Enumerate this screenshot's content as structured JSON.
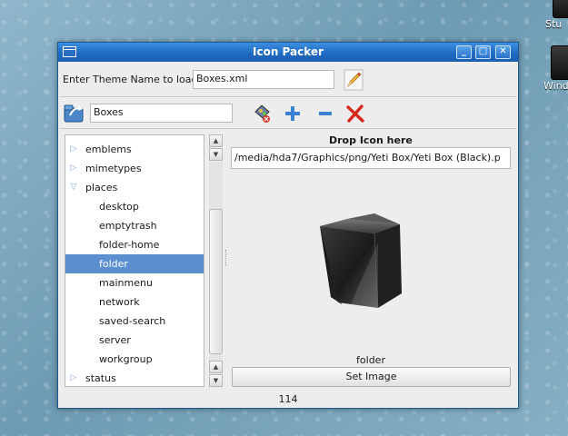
{
  "desktop": {
    "icons": [
      {
        "label": "Stu",
        "icon": "drive-icon"
      },
      {
        "label": "Wind",
        "icon": "drive-icon"
      }
    ]
  },
  "window": {
    "title": "Icon Packer",
    "controls": {
      "minimize": "_",
      "maximize": "□",
      "close": "✕"
    }
  },
  "theme_row": {
    "label": "Enter Theme Name to load",
    "value": "Boxes.xml",
    "edit_icon": "pencil-icon"
  },
  "toolbar": {
    "name_value": "Boxes",
    "icons": [
      "open-folder-icon",
      "palette-icon",
      "add-icon",
      "remove-icon",
      "delete-icon"
    ]
  },
  "tree": {
    "items": [
      {
        "label": "emblems",
        "type": "category",
        "expanded": false
      },
      {
        "label": "mimetypes",
        "type": "category",
        "expanded": false
      },
      {
        "label": "places",
        "type": "category",
        "expanded": true
      },
      {
        "label": "desktop",
        "type": "child"
      },
      {
        "label": "emptytrash",
        "type": "child"
      },
      {
        "label": "folder-home",
        "type": "child"
      },
      {
        "label": "folder",
        "type": "child",
        "selected": true
      },
      {
        "label": "mainmenu",
        "type": "child"
      },
      {
        "label": "network",
        "type": "child"
      },
      {
        "label": "saved-search",
        "type": "child"
      },
      {
        "label": "server",
        "type": "child"
      },
      {
        "label": "workgroup",
        "type": "child"
      },
      {
        "label": "status",
        "type": "category",
        "expanded": false
      }
    ]
  },
  "drop": {
    "label": "Drop Icon here",
    "path": "/media/hda7/Graphics/png/Yeti Box/Yeti Box (Black).p",
    "icon_name": "folder",
    "set_button": "Set Image"
  },
  "status": {
    "count": "114"
  },
  "colors": {
    "titlebar": "#1f6bc4",
    "selection": "#5b8fd0",
    "desktop": "#7fa8bf"
  }
}
